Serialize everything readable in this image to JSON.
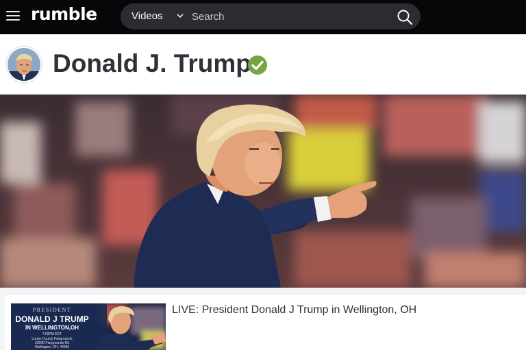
{
  "header": {
    "logo_text": "rumble",
    "search_category": "Videos",
    "search_placeholder": "Search",
    "menu_icon": "hamburger-menu-icon",
    "search_icon": "magnifier-icon"
  },
  "channel": {
    "name": "Donald J. Trump",
    "verified_icon": "checkmark-badge-icon",
    "verified_color": "#75a642"
  },
  "videos": [
    {
      "title": "LIVE: President Donald J Trump in Wellington, OH",
      "thumb_line1": "PRESIDENT",
      "thumb_line2": "DONALD J TRUMP",
      "thumb_line3": "IN WELLINGTON,OH",
      "thumb_line4": "7:00PM EDT",
      "thumb_line5": "Lorain County Fairgrounds",
      "thumb_line6": "23000 Fairgrounds Rd",
      "thumb_line7": "Wellington, OH, 44090"
    }
  ],
  "colors": {
    "topbar": "#060708",
    "searchbox": "#2a2c30",
    "page_bg": "#f3f4f6",
    "text": "#2d3238"
  }
}
